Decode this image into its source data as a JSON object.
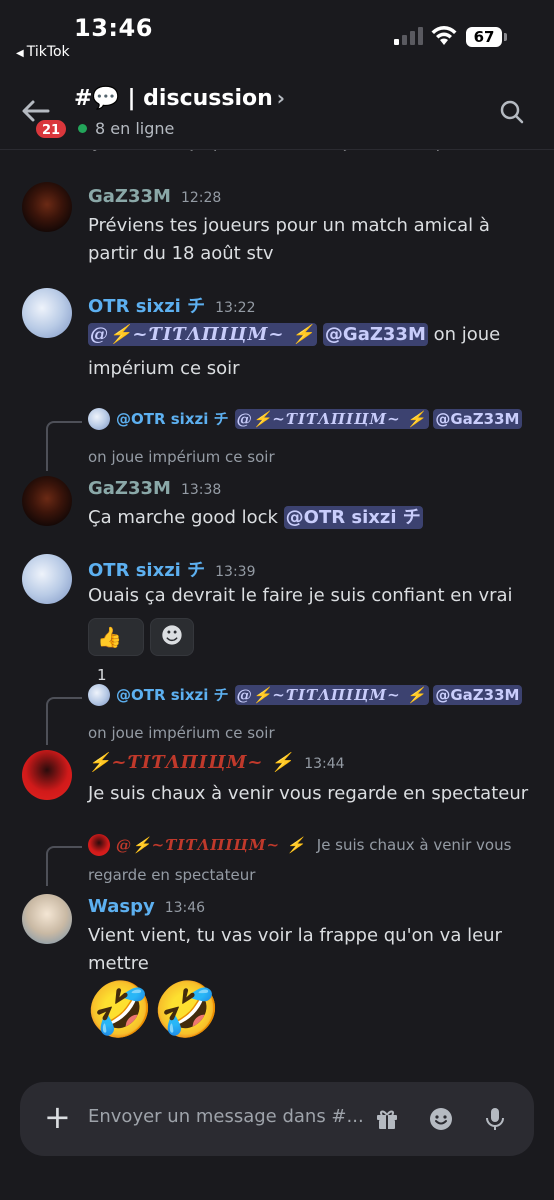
{
  "status_bar": {
    "time": "13:46",
    "back_app": "TikTok",
    "battery": "67"
  },
  "header": {
    "badge": "21",
    "channel_name": "#💬 | discussion",
    "online": "8 en ligne"
  },
  "messages": [
    {
      "partial_text": "Ça marche je préviens mais joueur ou pas ?"
    },
    {
      "author": "GaZ33M",
      "time": "12:28",
      "text": "Préviens tes joueurs pour un match amical à partir du 18 août stv"
    },
    {
      "author": "OTR sixzi チ",
      "time": "13:22",
      "mention1": "@⚡~ƬIƬΛПIЦM~ ⚡",
      "mention2": "@GaZ33M",
      "text_after": "on joue impérium ce soir"
    },
    {
      "reply": {
        "author": "@OTR sixzi チ",
        "mention1": "@⚡~ƬIƬΛПIЦM~ ⚡",
        "mention2": "@GaZ33M",
        "sub": "on joue impérium ce soir"
      },
      "author": "GaZ33M",
      "time": "13:38",
      "text_before": "Ça marche good lock",
      "mention": "@OTR sixzi チ"
    },
    {
      "author": "OTR sixzi チ",
      "time": "13:39",
      "text": "Ouais ça devrait le faire je suis confiant en vrai",
      "reaction_emoji": "👍",
      "reaction_count": "1",
      "add_reaction": "☻"
    },
    {
      "reply": {
        "author": "@OTR sixzi チ",
        "mention1": "@⚡~ƬIƬΛПIЦM~ ⚡",
        "mention2": "@GaZ33M",
        "sub": "on joue impérium ce soir"
      },
      "author": "⚡~ƬIƬΛПIЦM~ ⚡",
      "time": "13:44",
      "text": "Je suis chaux à venir vous regarde en spectateur"
    },
    {
      "reply": {
        "author": "@⚡~ƬIƬΛПIЦM~ ⚡",
        "text": "Je suis chaux à venir vous",
        "sub": "regarde en spectateur"
      },
      "author": "Waspy",
      "time": "13:46",
      "text": "Vient vient, tu vas voir la frappe qu'on va leur mettre",
      "emojis": "🤣🤣"
    }
  ],
  "composer": {
    "placeholder": "Envoyer un message dans #..."
  },
  "colors": {
    "background": "#1a1a1e",
    "mention_bg": "#3c4270",
    "name_blue": "#5db0f0",
    "titanium_red": "#c0392b",
    "online_green": "#23a55a"
  }
}
